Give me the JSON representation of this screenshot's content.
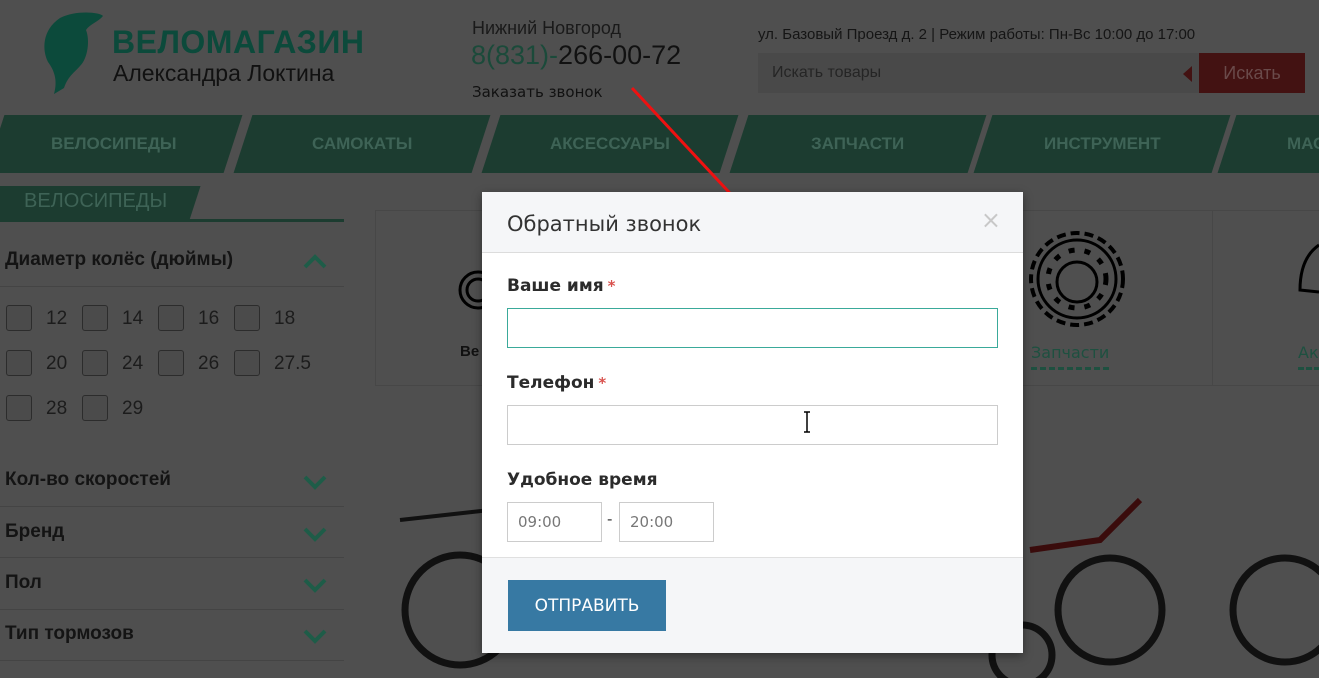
{
  "header": {
    "logo_title": "ВЕЛОМАГАЗИН",
    "logo_subtitle": "Александра Локтина",
    "city": "Нижний Новгород",
    "phone_code": "8(831)-",
    "phone_number": "266-00-72",
    "callback_link": "Заказать звонок",
    "address": "ул. Базовый Проезд д. 2 | Режим работы: Пн-Вс 10:00 до 17:00",
    "search_placeholder": "Искать товары",
    "search_button": "Искать"
  },
  "nav": [
    "ВЕЛОСИПЕДЫ",
    "САМОКАТЫ",
    "АКСЕССУАРЫ",
    "ЗАПЧАСТИ",
    "ИНСТРУМЕНТ",
    "МАСЛА"
  ],
  "sidebar": {
    "section_title": "ВЕЛОСИПЕДЫ",
    "wheel_filter": {
      "title": "Диаметр колёс (дюймы)",
      "options": [
        "12",
        "14",
        "16",
        "18",
        "20",
        "24",
        "26",
        "27.5",
        "28",
        "29"
      ]
    },
    "filters": [
      "Кол-во скоростей",
      "Бренд",
      "Пол",
      "Тип тормозов"
    ]
  },
  "categories": [
    {
      "label": "Ве",
      "icon": "wheel-icon"
    },
    {
      "label": "Запчасти",
      "icon": "sprocket-icon"
    },
    {
      "label": "Ак",
      "icon": "helmet-icon"
    }
  ],
  "modal": {
    "title": "Обратный звонок",
    "close": "×",
    "name_label": "Ваше имя",
    "phone_label": "Телефон",
    "required_mark": "*",
    "time_label": "Удобное время",
    "time_from": "09:00",
    "time_separator": "-",
    "time_to": "20:00",
    "submit": "ОТПРАВИТЬ"
  },
  "colors": {
    "brand_green": "#0c4a3b",
    "submit_blue": "#3779a3",
    "required_red": "#d9534f",
    "annotation_arrow": "#ee1111"
  }
}
